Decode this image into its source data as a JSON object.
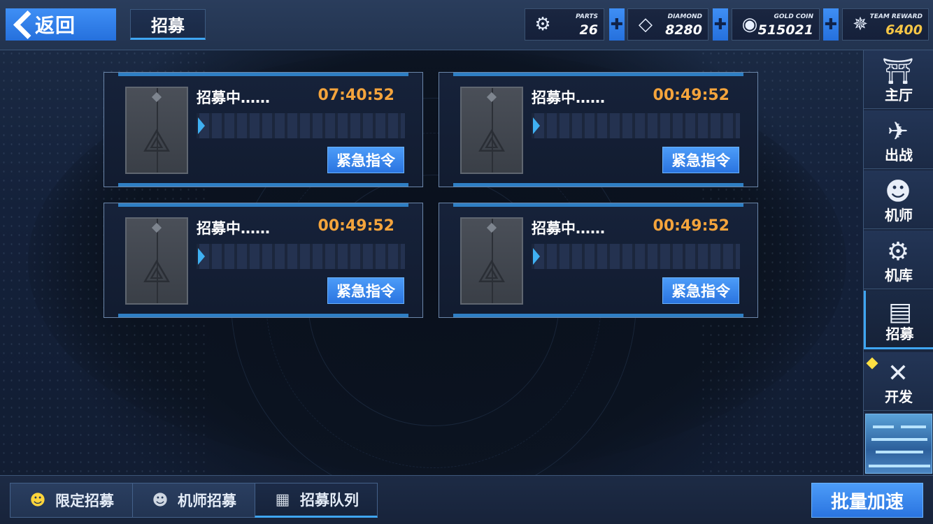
{
  "topbar": {
    "back_label": "返回",
    "page_title": "招募",
    "resources": [
      {
        "key": "parts",
        "label": "PARTS",
        "value": "26",
        "icon": "parts-icon",
        "color": "#ffffff"
      },
      {
        "key": "diamond",
        "label": "DIAMOND",
        "value": "8280",
        "icon": "diamond-icon",
        "color": "#ffffff"
      },
      {
        "key": "gold_coin",
        "label": "GOLD COIN",
        "value": "515021",
        "icon": "gold-coin-icon",
        "color": "#ffffff"
      },
      {
        "key": "team_reward",
        "label": "TEAM REWARD",
        "value": "6400",
        "icon": "team-reward-icon",
        "color": "#f6c646"
      }
    ]
  },
  "queue": {
    "slots": [
      {
        "status": "招募中……",
        "timer": "07:40:52",
        "progress": 0,
        "button": "紧急指令"
      },
      {
        "status": "招募中……",
        "timer": "00:49:52",
        "progress": 0,
        "button": "紧急指令"
      },
      {
        "status": "招募中……",
        "timer": "00:49:52",
        "progress": 0,
        "button": "紧急指令"
      },
      {
        "status": "招募中……",
        "timer": "00:49:52",
        "progress": 0,
        "button": "紧急指令"
      }
    ]
  },
  "sidenav": {
    "items": [
      {
        "label": "主厅",
        "icon": "lobby-icon",
        "active": false
      },
      {
        "label": "出战",
        "icon": "sortie-icon",
        "active": false
      },
      {
        "label": "机师",
        "icon": "pilot-icon",
        "active": false
      },
      {
        "label": "机库",
        "icon": "hangar-icon",
        "active": false
      },
      {
        "label": "招募",
        "icon": "recruit-icon",
        "active": true
      },
      {
        "label": "开发",
        "icon": "develop-icon",
        "active": false,
        "badge": true
      }
    ]
  },
  "bottombar": {
    "tabs": [
      {
        "label": "限定招募",
        "icon": "limited-recruit-icon",
        "active": false
      },
      {
        "label": "机师招募",
        "icon": "pilot-recruit-icon",
        "active": false
      },
      {
        "label": "招募队列",
        "icon": "queue-list-icon",
        "active": true
      }
    ],
    "speed_up_label": "批量加速"
  },
  "colors": {
    "accent": "#3f8ff5",
    "timer": "#f4a43c",
    "team_reward": "#f6c646",
    "badge": "#ffe043"
  }
}
